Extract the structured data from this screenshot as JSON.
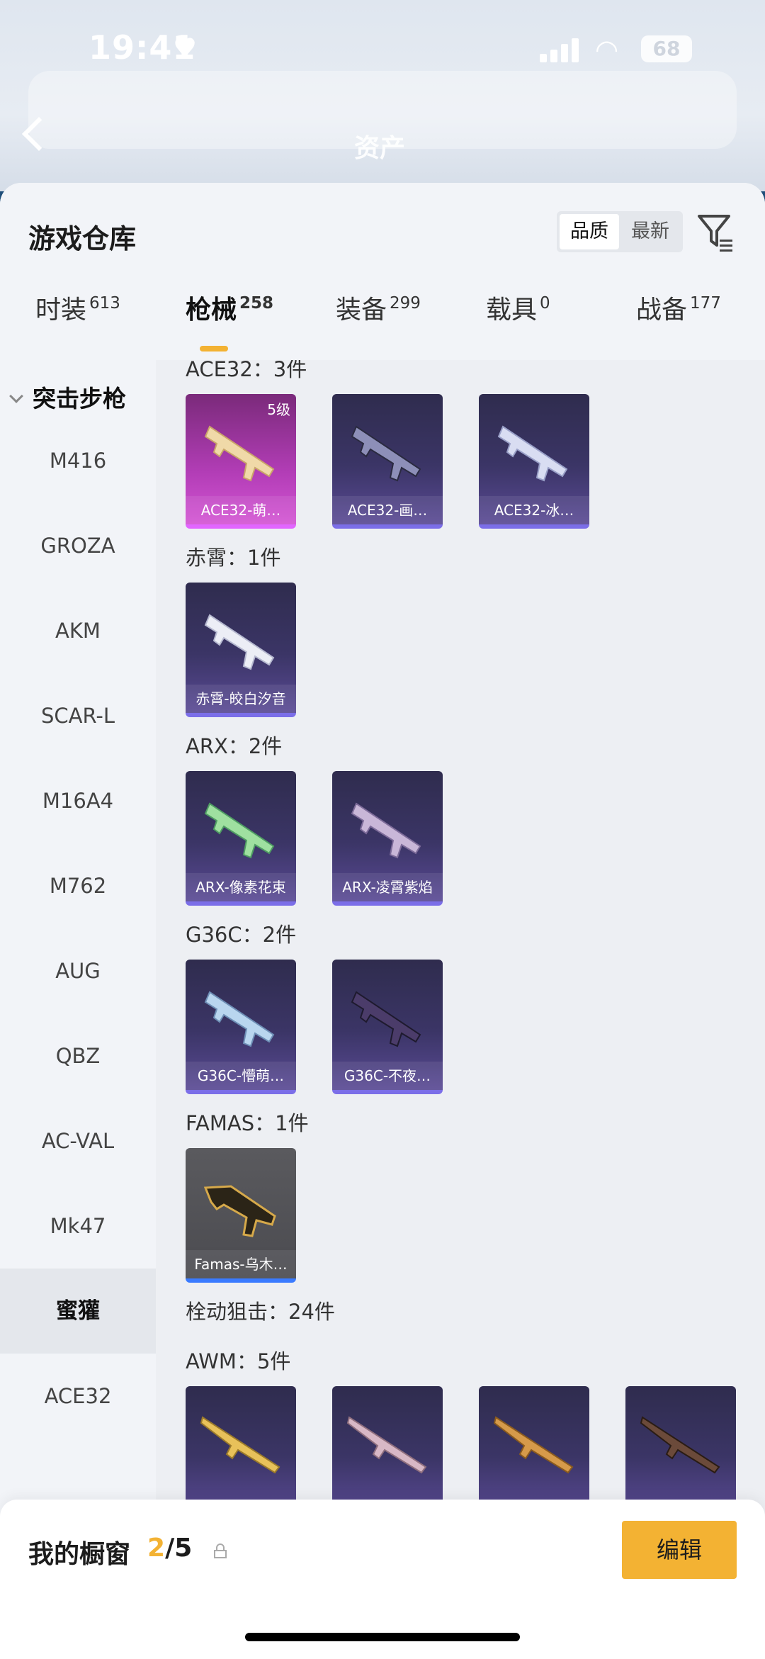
{
  "status_bar": {
    "time": "19:41",
    "battery": "68"
  },
  "background_header": {
    "title": "资产"
  },
  "sheet": {
    "title": "游戏仓库",
    "sort_options": [
      "品质",
      "最新"
    ],
    "tabs": [
      {
        "label": "时装",
        "count": "613"
      },
      {
        "label": "枪械",
        "count": "258"
      },
      {
        "label": "装备",
        "count": "299"
      },
      {
        "label": "载具",
        "count": "0"
      },
      {
        "label": "战备",
        "count": "177"
      }
    ]
  },
  "sidebar": {
    "group_label": "突击步枪",
    "items": [
      "M416",
      "GROZA",
      "AKM",
      "SCAR-L",
      "M16A4",
      "M762",
      "AUG",
      "QBZ",
      "AC-VAL",
      "Mk47",
      "蜜獾",
      "ACE32"
    ]
  },
  "content": {
    "sections": [
      {
        "heading": "ACE32：3件",
        "cards": [
          {
            "caption": "ACE32-萌…",
            "level": "5级",
            "rarity": "pink"
          },
          {
            "caption": "ACE32-画…",
            "rarity": "purple"
          },
          {
            "caption": "ACE32-冰…",
            "rarity": "purple"
          }
        ]
      },
      {
        "heading": "赤霄：1件",
        "cards": [
          {
            "caption": "赤霄-皎白汐音",
            "rarity": "purple"
          }
        ]
      },
      {
        "heading": "ARX：2件",
        "cards": [
          {
            "caption": "ARX-像素花束",
            "rarity": "purple"
          },
          {
            "caption": "ARX-凌霄紫焰",
            "rarity": "purple"
          }
        ]
      },
      {
        "heading": "G36C：2件",
        "cards": [
          {
            "caption": "G36C-懵萌…",
            "rarity": "purple"
          },
          {
            "caption": "G36C-不夜…",
            "rarity": "purple"
          }
        ]
      },
      {
        "heading": "FAMAS：1件",
        "cards": [
          {
            "caption": "Famas-乌木…",
            "rarity": "gray"
          }
        ]
      }
    ],
    "sniper_heading": "栓动狙击：24件",
    "awm_heading": "AWM：5件"
  },
  "showcase": {
    "label": "我的橱窗",
    "current": "2",
    "total": "/5",
    "edit_label": "编辑"
  },
  "colors": {
    "accent": "#f3b233",
    "epic_purple": "#5a4a95",
    "legendary_pink": "#d455d4"
  }
}
